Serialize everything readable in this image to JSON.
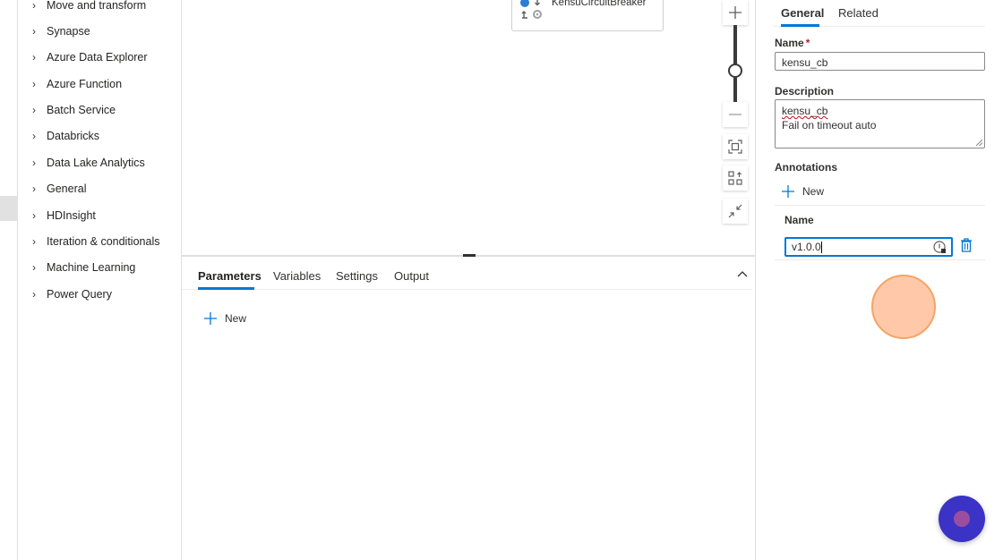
{
  "activities": {
    "items": [
      "Move and transform",
      "Synapse",
      "Azure Data Explorer",
      "Azure Function",
      "Batch Service",
      "Databricks",
      "Data Lake Analytics",
      "General",
      "HDInsight",
      "Iteration & conditionals",
      "Machine Learning",
      "Power Query"
    ]
  },
  "canvas": {
    "activity_label": "KensuCircuitBreaker",
    "zoom": {
      "level": 0.5
    }
  },
  "bottom_panel": {
    "tabs": [
      "Parameters",
      "Variables",
      "Settings",
      "Output"
    ],
    "active_tab": "Parameters",
    "new_label": "New"
  },
  "properties": {
    "tabs": [
      "General",
      "Related"
    ],
    "active_tab": "General",
    "name_label": "Name",
    "required_mark": "*",
    "name_value": "kensu_cb",
    "description_label": "Description",
    "description_lines": [
      "kensu_cb",
      "Fail on timeout auto"
    ],
    "annotations_label": "Annotations",
    "new_label": "New",
    "annotation_column_header": "Name",
    "annotation_value": "v1.0.0"
  },
  "colors": {
    "accent": "#0078d4",
    "fab": "#3b33c6",
    "click_indicator": "#ffc09a"
  }
}
